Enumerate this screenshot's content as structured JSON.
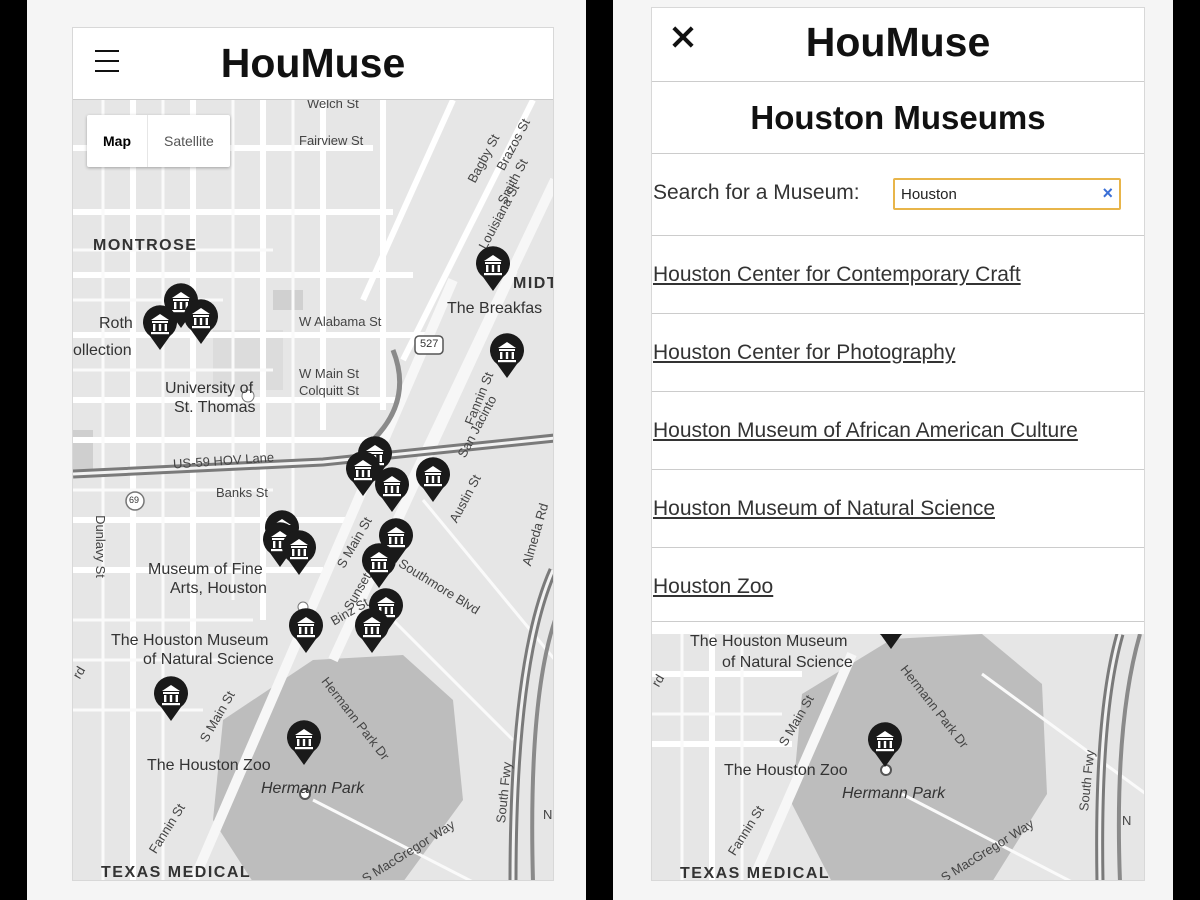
{
  "app": {
    "title": "HouMuse"
  },
  "map": {
    "type_control": {
      "map": "Map",
      "satellite": "Satellite"
    },
    "labels": {
      "welch": "Welch St",
      "fairview": "Fairview St",
      "bagby": "Bagby St",
      "brazos": "Brazos St",
      "smith": "Smith St",
      "louisiana": "Louisiana St",
      "montrose": "MONTROSE",
      "midtown": "MIDTO",
      "breakfast": "The Breakfas",
      "roth": "Roth",
      "collection": "ollection",
      "w_alabama": "W Alabama St",
      "route": "527",
      "w_main": "W Main St",
      "colquitt": "Colquitt St",
      "fannin": "Fannin St",
      "san_jacinto": "San Jacinto",
      "ust_1": "University of",
      "ust_2": "St. Thomas",
      "hov": "US-59 HOV Lane",
      "us59": "69",
      "banks": "Banks St",
      "dunlavy": "Dunlavy St",
      "austin": "Austin St",
      "almeda": "Almeda Rd",
      "s_main_1": "S Main St",
      "mfa_1": "Museum of Fine",
      "mfa_2": "Arts, Houston",
      "sunset": "Sunset",
      "binz": "Binz St",
      "southmore": "Southmore Blvd",
      "hmns_1": "The Houston Museum",
      "hmns_2": "of Natural Science",
      "s_main_2": "S Main St",
      "hermann_dr": "Hermann Park Dr",
      "zoo": "The Houston Zoo",
      "park": "Hermann Park",
      "fannin_2": "Fannin St",
      "macgregor": "S MacGregor Way",
      "south_fwy": "South Fwy",
      "tmc": "TEXAS MEDICAL",
      "rd": "rd",
      "nn": "N"
    }
  },
  "menu": {
    "heading": "Houston Museums",
    "search_label": "Search for a Museum:",
    "search_value": "Houston",
    "clear_icon": "×",
    "results": [
      {
        "label": "Houston Center for Contemporary Craft"
      },
      {
        "label": "Houston Center for Photography"
      },
      {
        "label": "Houston Museum of African American Culture"
      },
      {
        "label": "Houston Museum of Natural Science"
      },
      {
        "label": "Houston Zoo"
      }
    ]
  },
  "colors": {
    "search_focus": "#e8b54a",
    "pin": "#1a1a1a",
    "clear_x": "#3a6fd6"
  }
}
